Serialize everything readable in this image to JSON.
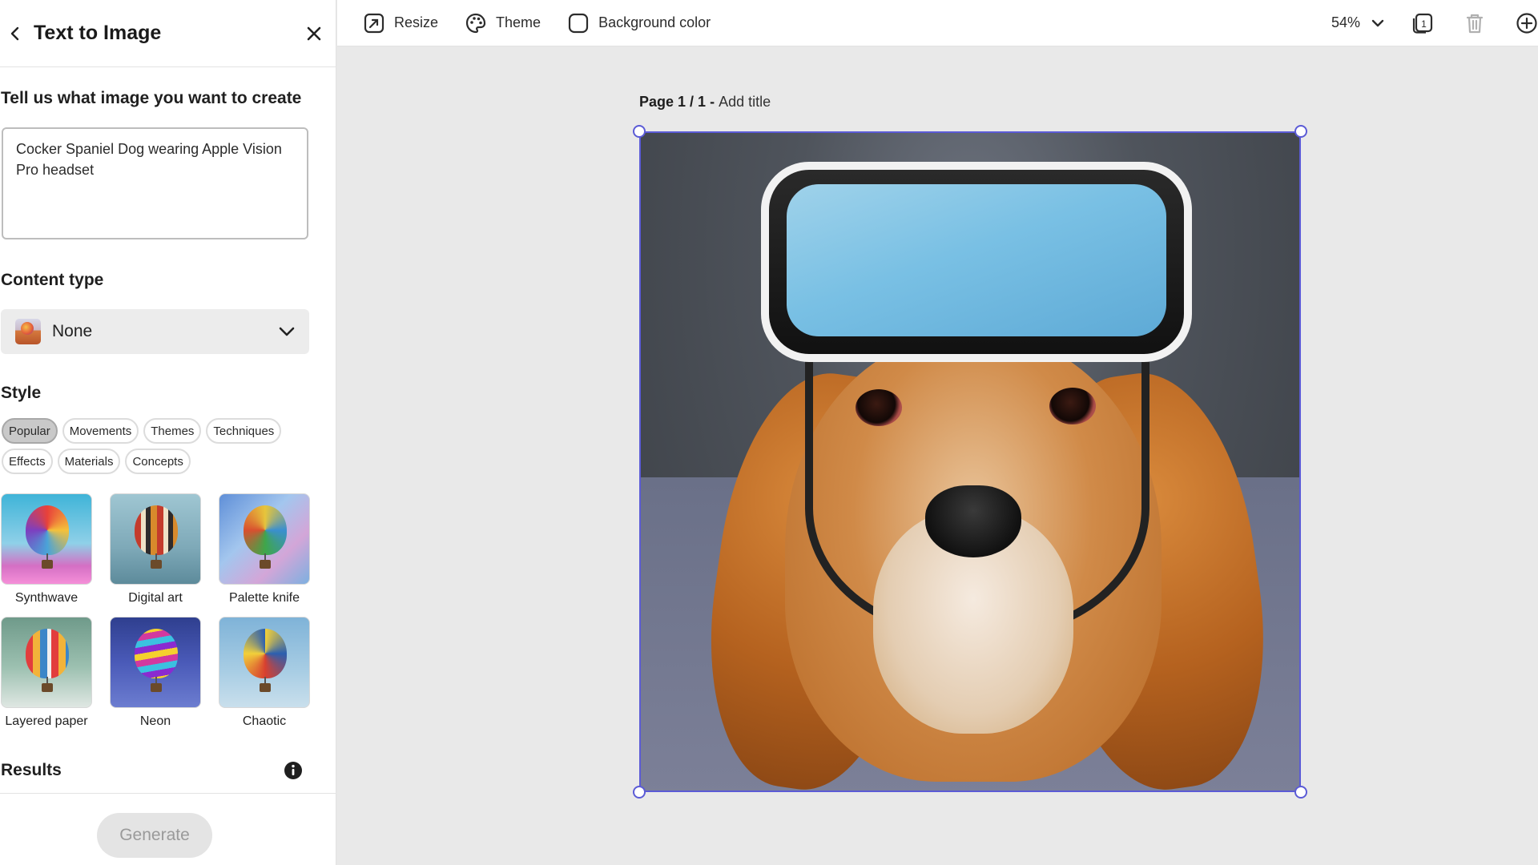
{
  "panel": {
    "title": "Text to Image",
    "prompt_label": "Tell us what image you want to create",
    "prompt_value": "Cocker Spaniel Dog wearing Apple Vision Pro headset",
    "content_type_label": "Content type",
    "content_type_value": "None",
    "style_label": "Style",
    "style_tabs": [
      "Popular",
      "Movements",
      "Themes",
      "Techniques",
      "Effects",
      "Materials",
      "Concepts"
    ],
    "active_style_tab": "Popular",
    "styles": [
      "Synthwave",
      "Digital art",
      "Palette knife",
      "Layered paper",
      "Neon",
      "Chaotic"
    ],
    "results_label": "Results",
    "generate_label": "Generate"
  },
  "toolbar": {
    "resize_label": "Resize",
    "theme_label": "Theme",
    "background_label": "Background color",
    "zoom": "54%",
    "pages_count": "1"
  },
  "canvas": {
    "page_indicator": "Page 1 / 1",
    "separator": " - ",
    "add_title": "Add title"
  },
  "colors": {
    "selection": "#5b5bd6",
    "chip_active": "#c9c9c9",
    "generate_disabled_bg": "#e4e4e4"
  }
}
